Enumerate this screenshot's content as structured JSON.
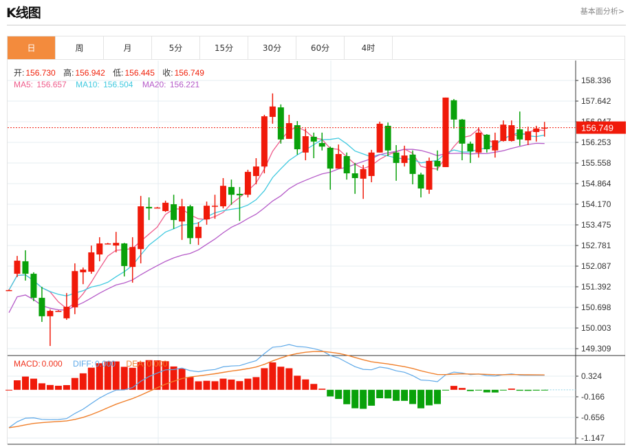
{
  "header": {
    "title": "K线图",
    "link": "基本面分析>"
  },
  "tabs": [
    {
      "label": "日",
      "active": true
    },
    {
      "label": "周",
      "active": false
    },
    {
      "label": "月",
      "active": false
    },
    {
      "label": "5分",
      "active": false
    },
    {
      "label": "15分",
      "active": false
    },
    {
      "label": "30分",
      "active": false
    },
    {
      "label": "60分",
      "active": false
    },
    {
      "label": "4时",
      "active": false
    }
  ],
  "ohlc": {
    "open_label": "开:",
    "open": "156.730",
    "high_label": "高:",
    "high": "156.942",
    "low_label": "低:",
    "low": "156.445",
    "close_label": "收:",
    "close": "156.749"
  },
  "ma": {
    "ma5_label": "MA5: ",
    "ma5": "156.657",
    "ma10_label": "MA10: ",
    "ma10": "156.504",
    "ma20_label": "MA20: ",
    "ma20": "156.221"
  },
  "macd_legend": {
    "macd_label": "MACD:",
    "macd": "0.000",
    "diff_label": "DIFF:",
    "diff": "0.000",
    "dea_label": "DEA:",
    "dea": "0.000"
  },
  "colors": {
    "up": "#f01a0a",
    "down": "#09a10a",
    "active_tab": "#f38b3d",
    "ma5": "#ee5a8a",
    "ma10": "#3fc9df",
    "ma20": "#b55ac8",
    "diff": "#5ca8e8",
    "dea": "#f07f2a",
    "grid": "#e6ecf2"
  },
  "chart_data": {
    "type": "candlestick",
    "candle_fields": [
      "open",
      "close",
      "high",
      "low"
    ],
    "candles": [
      [
        151.28,
        151.28,
        151.3,
        151.26
      ],
      [
        151.83,
        152.27,
        152.43,
        151.72
      ],
      [
        152.25,
        151.83,
        152.62,
        151.6
      ],
      [
        151.83,
        151.02,
        151.88,
        150.91
      ],
      [
        151.02,
        150.4,
        151.39,
        150.21
      ],
      [
        150.4,
        150.58,
        150.63,
        149.4
      ],
      [
        150.58,
        150.58,
        150.6,
        150.56
      ],
      [
        150.33,
        150.72,
        151.18,
        150.28
      ],
      [
        150.7,
        151.92,
        152.18,
        150.47
      ],
      [
        151.88,
        151.97,
        152.04,
        151.48
      ],
      [
        151.9,
        152.55,
        152.78,
        151.83
      ],
      [
        152.48,
        152.85,
        153.06,
        152.25
      ],
      [
        152.85,
        152.85,
        152.87,
        152.83
      ],
      [
        152.78,
        152.87,
        153.24,
        152.55
      ],
      [
        152.85,
        152.09,
        152.87,
        151.74
      ],
      [
        152.06,
        152.73,
        153.06,
        151.53
      ],
      [
        152.66,
        154.1,
        154.45,
        152.18
      ],
      [
        154.08,
        154.03,
        154.4,
        153.64
      ],
      [
        154.06,
        154.06,
        154.08,
        154.04
      ],
      [
        153.94,
        154.22,
        154.29,
        153.91
      ],
      [
        154.17,
        153.64,
        154.49,
        153.34
      ],
      [
        153.59,
        154.1,
        154.35,
        152.97
      ],
      [
        154.1,
        153.03,
        154.15,
        152.83
      ],
      [
        153.03,
        153.41,
        153.57,
        152.8
      ],
      [
        153.66,
        154.12,
        154.26,
        153.48
      ],
      [
        154.12,
        154.12,
        154.49,
        153.68
      ],
      [
        154.1,
        154.79,
        155.05,
        154.03
      ],
      [
        154.75,
        154.49,
        155.0,
        154.15
      ],
      [
        154.52,
        154.47,
        154.75,
        153.61
      ],
      [
        154.49,
        155.26,
        155.33,
        154.4
      ],
      [
        155.12,
        155.44,
        155.72,
        154.84
      ],
      [
        155.44,
        157.13,
        157.18,
        155.21
      ],
      [
        157.11,
        157.46,
        157.9,
        156.88
      ],
      [
        157.43,
        156.35,
        157.53,
        156.21
      ],
      [
        156.37,
        156.9,
        157.18,
        156.37
      ],
      [
        156.83,
        156.02,
        156.97,
        155.84
      ],
      [
        155.91,
        156.46,
        156.72,
        155.65
      ],
      [
        156.44,
        156.28,
        156.58,
        155.72
      ],
      [
        156.23,
        156.11,
        156.58,
        155.98
      ],
      [
        156.07,
        155.37,
        156.11,
        154.66
      ],
      [
        155.37,
        155.86,
        156.18,
        155.37
      ],
      [
        155.79,
        155.21,
        155.91,
        155.0
      ],
      [
        155.21,
        155.05,
        155.56,
        154.52
      ],
      [
        155.03,
        155.35,
        155.49,
        154.35
      ],
      [
        155.12,
        155.91,
        156.0,
        154.91
      ],
      [
        155.91,
        156.88,
        156.95,
        155.91
      ],
      [
        156.81,
        155.98,
        156.92,
        155.79
      ],
      [
        155.91,
        155.56,
        156.16,
        154.96
      ],
      [
        155.56,
        155.81,
        156.14,
        155.44
      ],
      [
        155.84,
        155.19,
        155.98,
        154.84
      ],
      [
        155.17,
        154.7,
        155.23,
        154.4
      ],
      [
        154.66,
        155.63,
        155.74,
        154.52
      ],
      [
        155.63,
        155.44,
        155.98,
        155.3
      ],
      [
        155.42,
        157.76,
        157.76,
        155.42
      ],
      [
        157.67,
        157.02,
        157.71,
        156.72
      ],
      [
        157.02,
        156.21,
        157.04,
        155.65
      ],
      [
        156.21,
        155.95,
        156.28,
        155.56
      ],
      [
        155.91,
        156.58,
        156.74,
        155.74
      ],
      [
        156.51,
        156.02,
        156.53,
        155.91
      ],
      [
        155.98,
        156.32,
        156.58,
        155.74
      ],
      [
        156.3,
        156.85,
        156.99,
        156.28
      ],
      [
        156.3,
        156.83,
        156.99,
        156.28
      ],
      [
        156.69,
        156.35,
        157.29,
        156.14
      ],
      [
        156.32,
        156.62,
        156.78,
        156.16
      ],
      [
        156.6,
        156.72,
        156.81,
        156.28
      ],
      [
        156.73,
        156.749,
        156.942,
        156.445
      ]
    ],
    "ma_periods": [
      5,
      10,
      20
    ],
    "price_axis": {
      "range": [
        149.309,
        158.336
      ],
      "ticks": [
        "158.336",
        "157.642",
        "156.947",
        "156.253",
        "155.558",
        "154.864",
        "154.170",
        "153.475",
        "152.781",
        "152.087",
        "151.392",
        "150.698",
        "150.003",
        "149.309"
      ]
    },
    "current_price": "156.749",
    "macd_axis": {
      "range": [
        -1.147,
        0.324
      ],
      "ticks": [
        "0.324",
        "-0.166",
        "-0.656",
        "-1.147"
      ]
    },
    "grid": true
  }
}
